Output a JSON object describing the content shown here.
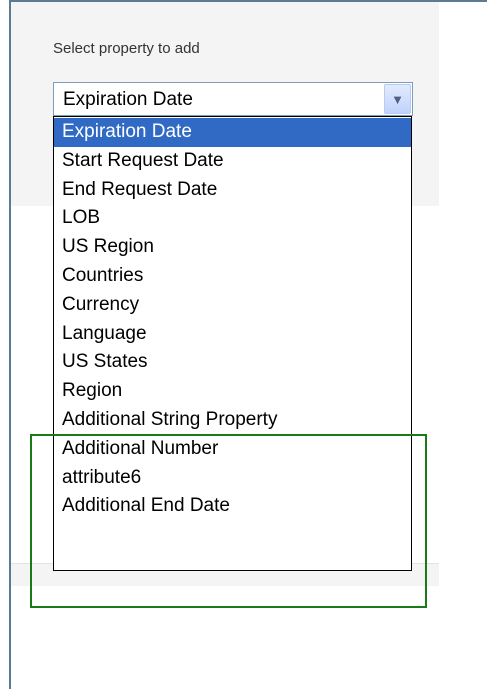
{
  "prompt_label": "Select property to add",
  "select": {
    "value": "Expiration Date",
    "arrow_icon": "chevron-down-icon"
  },
  "options": [
    "Expiration Date",
    "Start Request Date",
    "End Request Date",
    "LOB",
    "US Region",
    "Countries",
    "Currency",
    "Language",
    "US States",
    "Region",
    "Additional String Property",
    "Additional Number",
    "attribute6",
    "Additional End Date"
  ],
  "selected_index": 0,
  "colors": {
    "highlight_box": "#1a7a1a",
    "selection": "#316ac5",
    "frame": "#5a7b94"
  }
}
